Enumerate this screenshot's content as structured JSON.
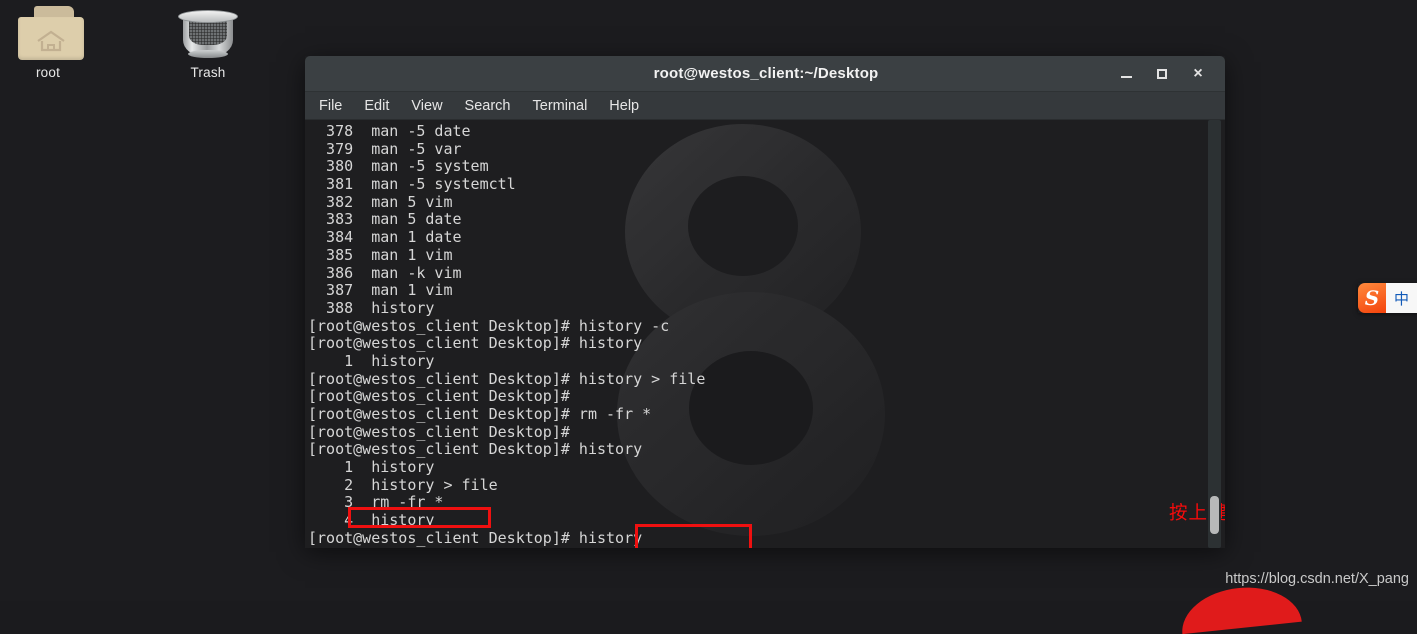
{
  "desktop": {
    "icons": [
      {
        "label": "root",
        "icon": "home-folder-icon"
      },
      {
        "label": "Trash",
        "icon": "trash-can-icon"
      }
    ],
    "watermark": "https://blog.csdn.net/X_pang"
  },
  "window": {
    "title": "root@westos_client:~/Desktop",
    "controls": {
      "minimize": "_",
      "maximize": "□",
      "close": "×"
    },
    "menu": [
      "File",
      "Edit",
      "View",
      "Search",
      "Terminal",
      "Help"
    ]
  },
  "terminal": {
    "prompt": "[root@westos_client Desktop]#",
    "lines": [
      "  378  man -5 date",
      "  379  man -5 var",
      "  380  man -5 system",
      "  381  man -5 systemctl",
      "  382  man 5 vim",
      "  383  man 5 date",
      "  384  man 1 date",
      "  385  man 1 vim",
      "  386  man -k vim",
      "  387  man 1 vim",
      "  388  history",
      "[root@westos_client Desktop]# history -c",
      "[root@westos_client Desktop]# history",
      "    1  history",
      "[root@westos_client Desktop]# history > file",
      "[root@westos_client Desktop]#",
      "[root@westos_client Desktop]# rm -fr *",
      "[root@westos_client Desktop]#",
      "[root@westos_client Desktop]# history",
      "    1  history",
      "    2  history > file",
      "    3  rm -fr *",
      "    4  history",
      "[root@westos_client Desktop]# history"
    ]
  },
  "annotations": {
    "note": "按上键 翻阅上一个历史",
    "note_color": "#f50b0b",
    "highlight_color": "#ef1010",
    "highlighted_history_entry": "    4  history",
    "highlighted_command": "history"
  },
  "ime": {
    "logo": "S",
    "mode": "中"
  }
}
